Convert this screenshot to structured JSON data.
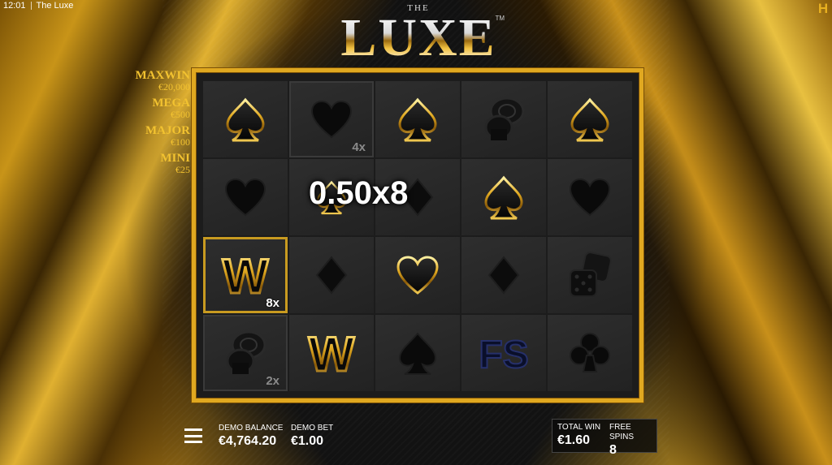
{
  "status_bar": {
    "time": "12:01",
    "title": "The Luxe"
  },
  "logo": {
    "the": "THE",
    "name": "LUXE",
    "tm": "TM"
  },
  "jackpots": [
    {
      "name": "MAXWIN",
      "value": "€20,000"
    },
    {
      "name": "MEGA",
      "value": "€500"
    },
    {
      "name": "MAJOR",
      "value": "€100"
    },
    {
      "name": "MINI",
      "value": "€25"
    }
  ],
  "grid": {
    "multipliers": {
      "r0c1": "4x",
      "r2c0": "8x",
      "r3c0": "2x"
    },
    "w_symbol": "W",
    "fs_symbol": "FS"
  },
  "win_display": "0.50x8",
  "bottom_bar": {
    "balance_label": "DEMO BALANCE",
    "balance_value": "€4,764.20",
    "bet_label": "DEMO BET",
    "bet_value": "€1.00",
    "total_win_label": "TOTAL WIN",
    "total_win_value": "€1.60",
    "free_spins_label": "FREE SPINS",
    "free_spins_value": "8"
  },
  "colors": {
    "gold": "#e0a820",
    "jackpot_text": "#f2c230"
  }
}
